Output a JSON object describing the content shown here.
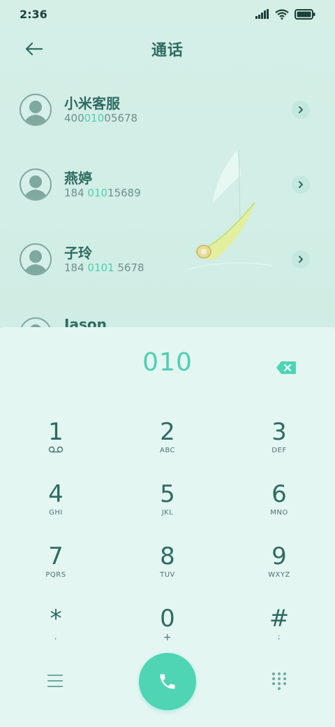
{
  "status_bar": {
    "time": "2:36"
  },
  "header": {
    "title": "通话"
  },
  "contacts": [
    {
      "name": "小米客服",
      "number_pre": "400",
      "number_hl": "010",
      "number_post": "05678"
    },
    {
      "name": "燕婷",
      "number_pre": "184 ",
      "number_hl": "010",
      "number_post": "15689"
    },
    {
      "name": "子玲",
      "number_pre": "184 ",
      "number_hl": "0101",
      "number_post": " 5678"
    },
    {
      "name": "Jason"
    }
  ],
  "dialer": {
    "input": "010",
    "keys": [
      {
        "digit": "1",
        "letters": ""
      },
      {
        "digit": "2",
        "letters": "ABC"
      },
      {
        "digit": "3",
        "letters": "DEF"
      },
      {
        "digit": "4",
        "letters": "GHI"
      },
      {
        "digit": "5",
        "letters": "JKL"
      },
      {
        "digit": "6",
        "letters": "MNO"
      },
      {
        "digit": "7",
        "letters": "PQRS"
      },
      {
        "digit": "8",
        "letters": "TUV"
      },
      {
        "digit": "9",
        "letters": "WXYZ"
      },
      {
        "digit": "*",
        "letters": ","
      },
      {
        "digit": "0",
        "letters": "+"
      },
      {
        "digit": "#",
        "letters": ";"
      }
    ]
  },
  "icons": {
    "back": "arrow-left-icon",
    "chevron": "chevron-right-icon",
    "backspace": "backspace-icon",
    "voicemail": "voicemail-icon",
    "menu": "menu-icon",
    "call": "phone-icon",
    "keypad": "keypad-icon"
  },
  "colors": {
    "accent": "#4fd4b4",
    "text": "#2f6b62",
    "background": "#d5efe7",
    "pad": "#e3f6f2"
  }
}
